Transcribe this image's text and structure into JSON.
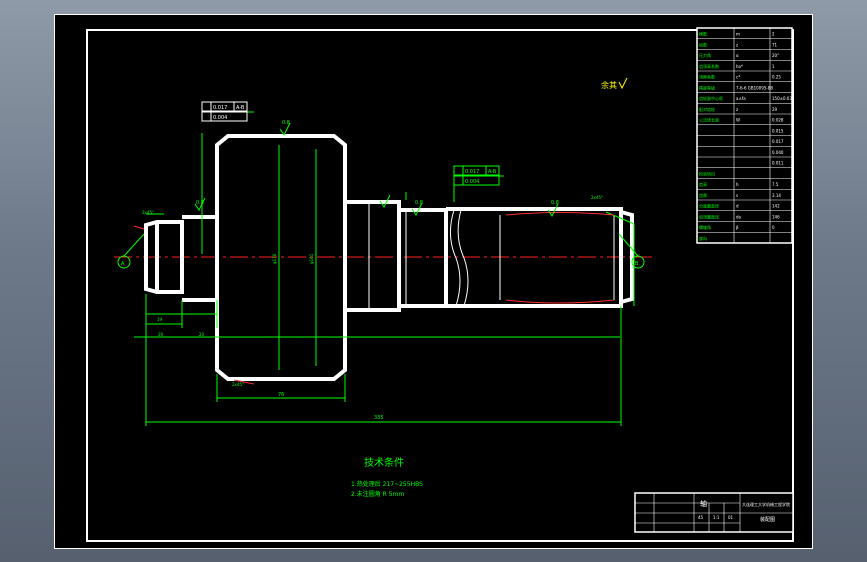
{
  "drawing": {
    "roughness_note": "余其",
    "notes_title": "技术条件",
    "note_1": "1.热处理后 217~255HBS",
    "note_2": "2.未注圆角 R 5mm",
    "tolerance_frame_1": [
      "0.017",
      "A-B",
      "0.004"
    ],
    "tolerance_frame_2": [
      "0.017",
      "A-B",
      "0.004"
    ],
    "roughness_values": [
      "0.8",
      "0.8",
      "0.8",
      "0.8",
      "0.8"
    ],
    "chamfer_labels": [
      "2x45°",
      "2x45°",
      "2x45°",
      "2x45°"
    ],
    "dimension_overall": "335",
    "dimension_gear_width": "76",
    "dimension_left_1": "19",
    "dimension_left_2": "29",
    "dimension_left_3": "20",
    "dimension_gear_diameter": "φ176",
    "dimension_root_diameter": "φ161",
    "datum_labels": [
      "A",
      "B"
    ]
  },
  "parameter_table": {
    "rows": [
      [
        "模数",
        "m",
        "2"
      ],
      [
        "齿数",
        "z",
        "71"
      ],
      [
        "压力角",
        "α",
        "20°"
      ],
      [
        "齿顶高系数",
        "ha*",
        "1"
      ],
      [
        "顶隙系数",
        "c*",
        "0.25"
      ],
      [
        "精度等级",
        "7-6-6 GB10095-88",
        ""
      ],
      [
        "齿轮副中心距",
        "a±fa",
        "150±0.032"
      ],
      [
        "配对齿轮",
        "z",
        "29"
      ],
      [
        "公法线长度",
        "W",
        "0.028"
      ],
      [
        "",
        "",
        "0.015"
      ],
      [
        "",
        "",
        "0.017"
      ],
      [
        "",
        "",
        "0.040"
      ],
      [
        "",
        "",
        "0.011"
      ],
      [
        "检验项目",
        "",
        ""
      ],
      [
        "齿高",
        "h",
        "7.5"
      ],
      [
        "齿厚",
        "s",
        "3.14"
      ],
      [
        "分度圆直径",
        "d",
        "142"
      ],
      [
        "齿顶圆直径",
        "da",
        "146"
      ],
      [
        "螺旋角",
        "β",
        "0"
      ],
      [
        "旋向",
        "",
        ""
      ]
    ]
  },
  "title_block": {
    "part_name": "轴",
    "school": "大连理工大学机械工程学院",
    "drawing_no": "装配图",
    "material": "45",
    "scale": "1:1",
    "sheet": "01"
  },
  "colors": {
    "outline": "#ffffff",
    "dimension": "#00ff00",
    "centerline": "#ff2020",
    "hatch": "#ff3030",
    "text": "#00ff00",
    "annotation": "#ffff00"
  }
}
